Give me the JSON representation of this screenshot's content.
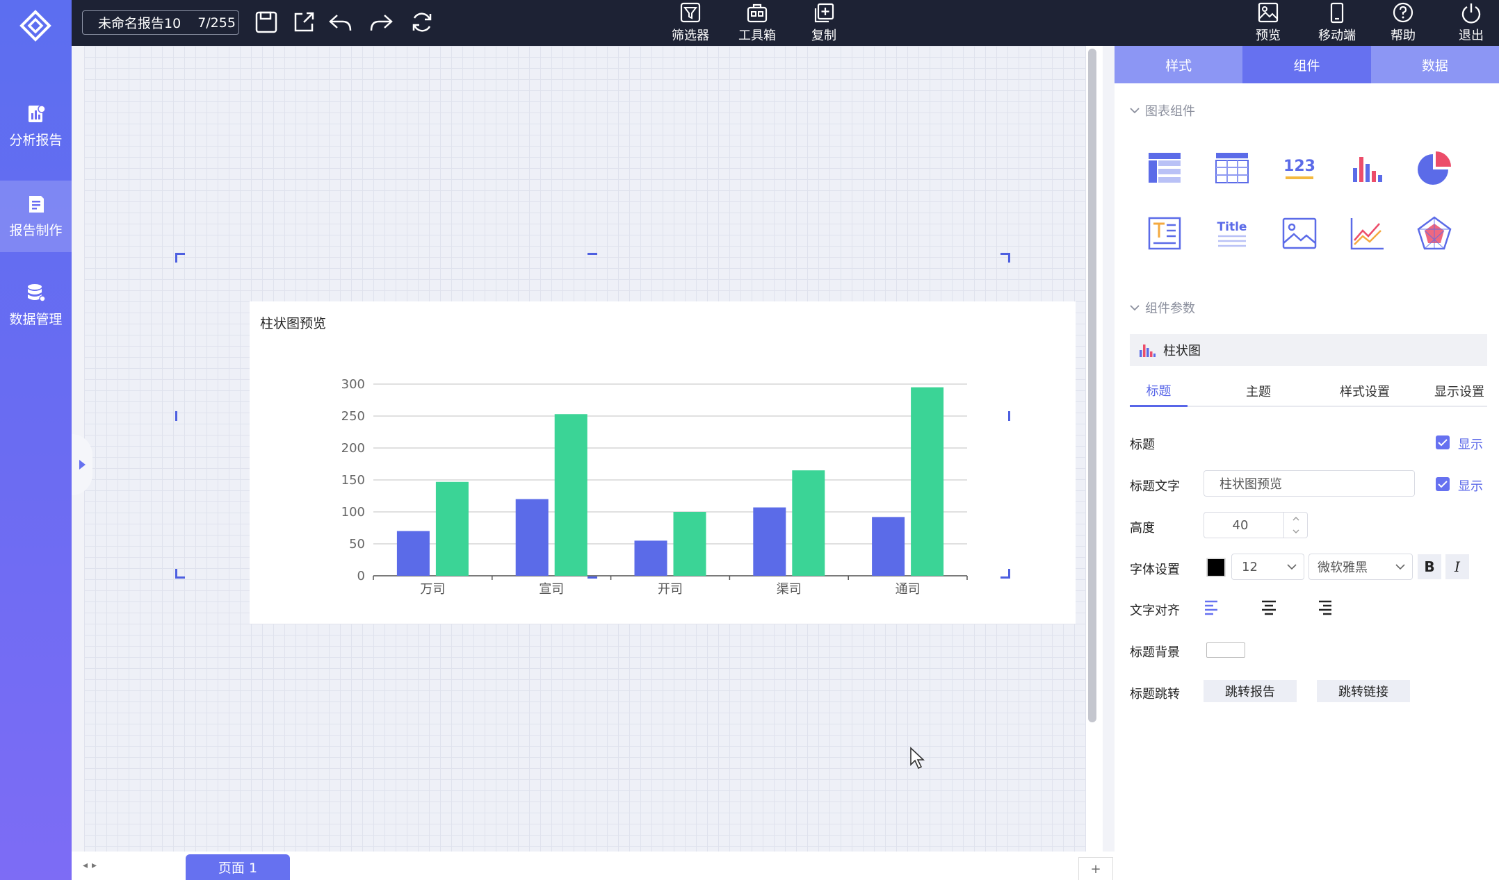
{
  "sidebar": {
    "items": [
      {
        "label": "分析报告",
        "icon": "analysis-report-icon"
      },
      {
        "label": "报告制作",
        "icon": "report-edit-icon",
        "active": true
      },
      {
        "label": "数据管理",
        "icon": "database-icon"
      }
    ]
  },
  "topbar": {
    "report_name": "未命名报告10",
    "report_count": "7/255",
    "tools": [
      {
        "label": "筛选器",
        "icon": "filter-icon"
      },
      {
        "label": "工具箱",
        "icon": "toolbox-icon"
      },
      {
        "label": "复制",
        "icon": "copy-icon"
      }
    ],
    "right_tools": [
      {
        "label": "预览",
        "icon": "preview-icon"
      },
      {
        "label": "移动端",
        "icon": "mobile-icon"
      },
      {
        "label": "帮助",
        "icon": "help-icon"
      },
      {
        "label": "退出",
        "icon": "power-icon"
      }
    ]
  },
  "canvas": {
    "chart_title": "柱状图预览"
  },
  "chart_data": {
    "type": "bar",
    "title": "柱状图预览",
    "categories": [
      "万司",
      "宣司",
      "开司",
      "渠司",
      "通司"
    ],
    "series": [
      {
        "values": [
          70,
          120,
          55,
          107,
          92
        ],
        "color": "#5b6be8"
      },
      {
        "values": [
          147,
          253,
          100,
          165,
          295
        ],
        "color": "#3bd496"
      }
    ],
    "yticks": [
      "0",
      "50",
      "100",
      "150",
      "200",
      "250",
      "300"
    ],
    "ylim": [
      0,
      300
    ],
    "grid": true
  },
  "bottom": {
    "page_tab": "页面 1",
    "add": "+"
  },
  "panel": {
    "tabs": [
      "样式",
      "组件",
      "数据"
    ],
    "active_tab": "组件",
    "section_components": "图表组件",
    "component_icons": [
      "table-icon",
      "cross-table-icon",
      "number-card-icon",
      "bar-chart-icon",
      "pie-chart-icon",
      "text-icon",
      "title-icon",
      "image-icon",
      "line-chart-icon",
      "radar-chart-icon"
    ],
    "title_icon_text": "Title",
    "number_icon_text": "123",
    "section_params": "组件参数",
    "chart_type": "柱状图",
    "sub_tabs": [
      "标题",
      "主题",
      "样式设置",
      "显示设置"
    ],
    "form": {
      "title_label": "标题",
      "show": "显示",
      "title_text_label": "标题文字",
      "title_text_value": "柱状图预览",
      "height_label": "高度",
      "height_value": "40",
      "font_label": "字体设置",
      "font_size": "12",
      "font_family": "微软雅黑",
      "bold": "B",
      "italic": "I",
      "align_label": "文字对齐",
      "bg_label": "标题背景",
      "jump_label": "标题跳转",
      "jump_report": "跳转报告",
      "jump_link": "跳转链接"
    }
  },
  "colors": {
    "accent": "#6671f0",
    "topbar": "#1d2234",
    "bar_blue": "#5b6be8",
    "bar_green": "#3bd496"
  }
}
